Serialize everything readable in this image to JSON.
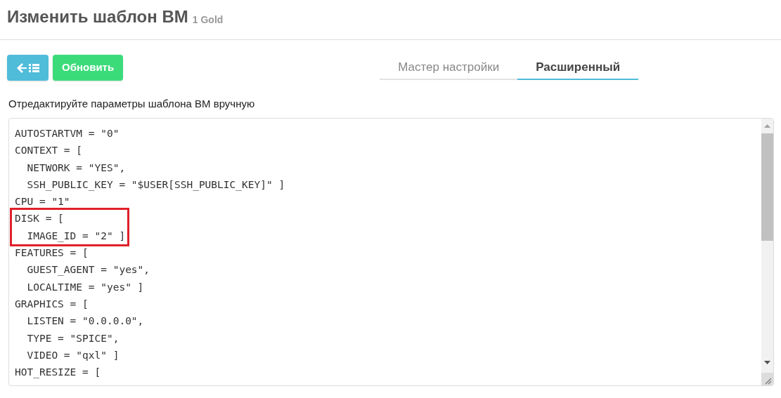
{
  "header": {
    "title": "Изменить шаблон ВМ",
    "subtitle": "1 Gold"
  },
  "buttons": [
    {
      "kind": "back"
    },
    {
      "kind": "update",
      "label": "Обновить"
    }
  ],
  "tabs": [
    {
      "label": "Мастер настройки",
      "selected": false
    },
    {
      "label": "Расширенный",
      "selected": true
    }
  ],
  "description": "Отредактируйте параметры шаблона ВМ вручную",
  "editor": {
    "blocks": [
      {
        "highlighted": false,
        "lines": [
          "AUTOSTARTVM = \"0\""
        ]
      },
      {
        "highlighted": false,
        "lines": [
          "CONTEXT = [",
          "  NETWORK = \"YES\",",
          "  SSH_PUBLIC_KEY = \"$USER[SSH_PUBLIC_KEY]\" ]"
        ]
      },
      {
        "highlighted": false,
        "lines": [
          "CPU = \"1\""
        ]
      },
      {
        "highlighted": true,
        "lines": [
          "DISK = [",
          "  IMAGE_ID = \"2\" ]"
        ]
      },
      {
        "highlighted": false,
        "lines": [
          "FEATURES = [",
          "  GUEST_AGENT = \"yes\",",
          "  LOCALTIME = \"yes\" ]"
        ]
      },
      {
        "highlighted": false,
        "lines": [
          "GRAPHICS = [",
          "  LISTEN = \"0.0.0.0\",",
          "  TYPE = \"SPICE\",",
          "  VIDEO = \"qxl\" ]"
        ]
      },
      {
        "highlighted": false,
        "lines": [
          "HOT_RESIZE = ["
        ]
      }
    ]
  }
}
